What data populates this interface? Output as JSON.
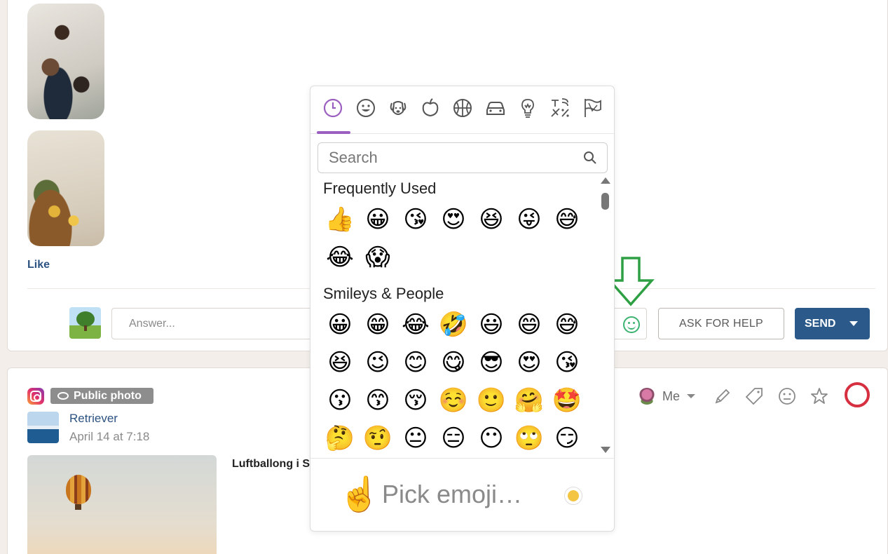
{
  "post1": {
    "like_label": "Like",
    "answer_placeholder": "Answer...",
    "ask_help_label": "ASK FOR HELP",
    "send_label": "SEND"
  },
  "post2": {
    "badge_label": "Public photo",
    "author": "Retriever",
    "date": "April 14 at 7:18",
    "text": "Luftballong i S",
    "assignee": "Me"
  },
  "emoji_picker": {
    "categories": [
      "recent",
      "smileys",
      "animals",
      "food",
      "activity",
      "travel",
      "objects",
      "symbols",
      "flags"
    ],
    "search_placeholder": "Search",
    "sections": [
      {
        "title": "Frequently Used",
        "emojis": [
          "👍",
          "😀",
          "😘",
          "😍",
          "😆",
          "😜",
          "😅",
          "😂",
          "😱"
        ]
      },
      {
        "title": "Smileys & People",
        "emojis": [
          "😀",
          "😁",
          "😂",
          "🤣",
          "😃",
          "😄",
          "😅",
          "😆",
          "😉",
          "😊",
          "😋",
          "😎",
          "😍",
          "😘",
          "😗",
          "😙",
          "😚",
          "☺️",
          "🙂",
          "🤗",
          "🤩",
          "🤔",
          "🤨",
          "😐",
          "😑",
          "😶",
          "🙄",
          "😏"
        ]
      }
    ],
    "preview_emoji": "☝️",
    "preview_text": "Pick emoji…",
    "skin_tone_color": "#f4c542"
  },
  "colors": {
    "accent_purple": "#9b5fc0",
    "send_blue": "#2b5a8a",
    "link_blue": "#2c5282",
    "arrow_green": "#2ea043",
    "status_red": "#d63040"
  }
}
